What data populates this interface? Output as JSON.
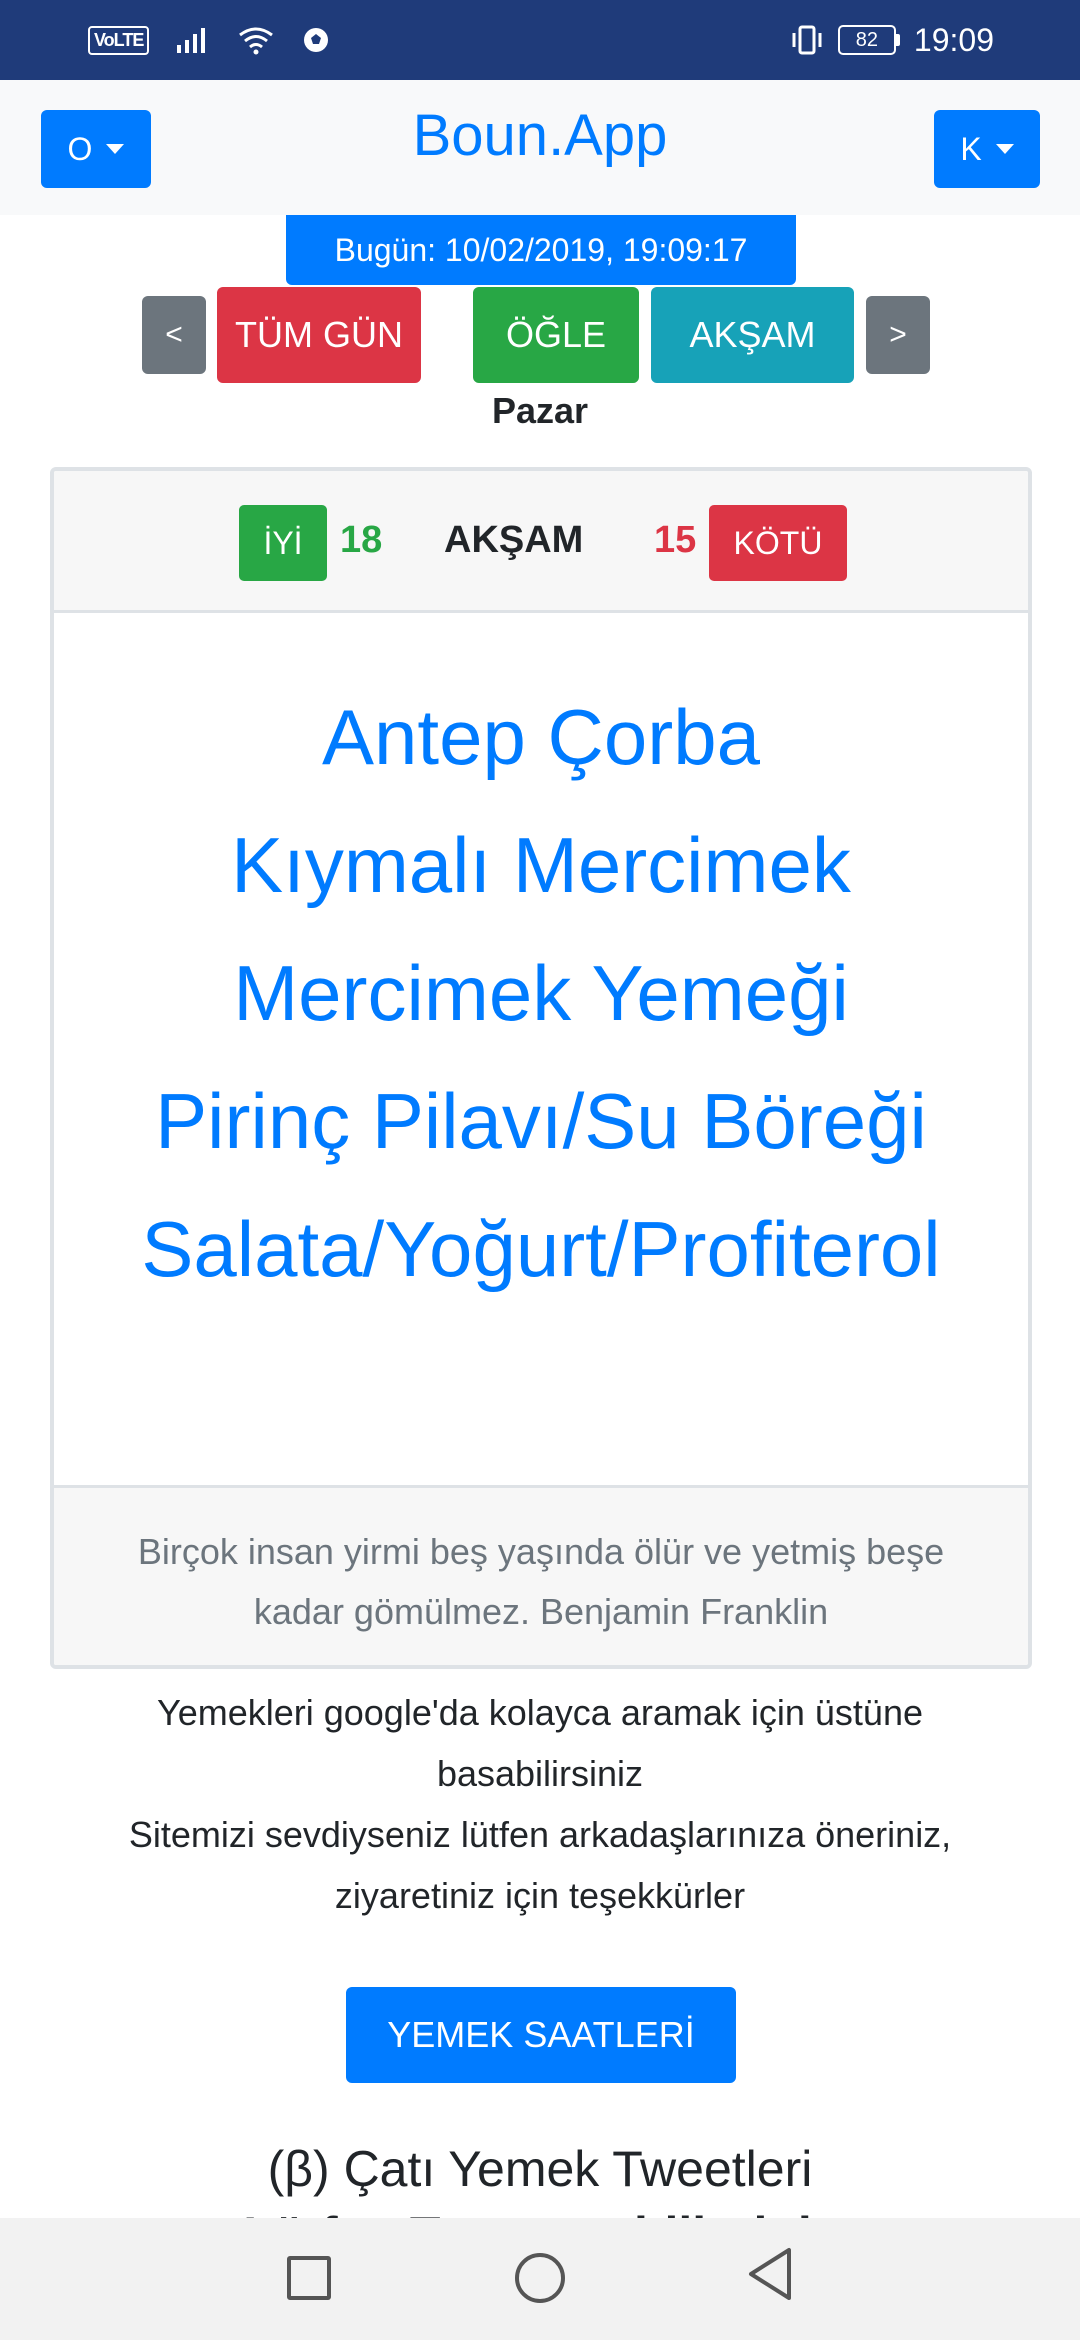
{
  "status_bar": {
    "volte": "VoLTE",
    "battery": "82",
    "time": "19:09"
  },
  "navbar": {
    "left_dropdown": "O",
    "brand": "Boun.App",
    "right_dropdown": "K"
  },
  "date_label": "Bugün: 10/02/2019, 19:09:17",
  "meal_buttons": {
    "prev": "<",
    "all_day": "TÜM GÜN",
    "noon": "ÖĞLE",
    "evening": "AKŞAM",
    "next": ">"
  },
  "day_name": "Pazar",
  "card": {
    "good_label": "İYİ",
    "good_count": "18",
    "meal_title": "AKŞAM",
    "bad_count": "15",
    "bad_label": "KÖTÜ",
    "menu_items": [
      "Antep Çorba",
      "Kıymalı Mercimek",
      "Mercimek Yemeği",
      "Pirinç Pilavı/Su Böreği",
      "Salata/Yoğurt/Profiterol"
    ],
    "quote": "Birçok insan yirmi beş yaşında ölür ve yetmiş beşe kadar gömülmez. Benjamin Franklin"
  },
  "info": {
    "line1": "Yemekleri google'da kolayca aramak için üstüne basabilirsiniz",
    "line2": "Sitemizi sevdiyseniz lütfen arkadaşlarınıza öneriniz, ziyaretiniz için teşekkürler"
  },
  "hours_button": "YEMEK SAATLERİ",
  "tweets": {
    "title": "(β) Çatı Yemek Tweetleri",
    "subtitle": "Lütfen Tweet atabilirsiniz"
  },
  "colors": {
    "primary": "#007bff",
    "success": "#28a745",
    "danger": "#dc3545",
    "info": "#17a2b8",
    "secondary": "#6c757d",
    "status_bar": "#1f3b7a"
  }
}
